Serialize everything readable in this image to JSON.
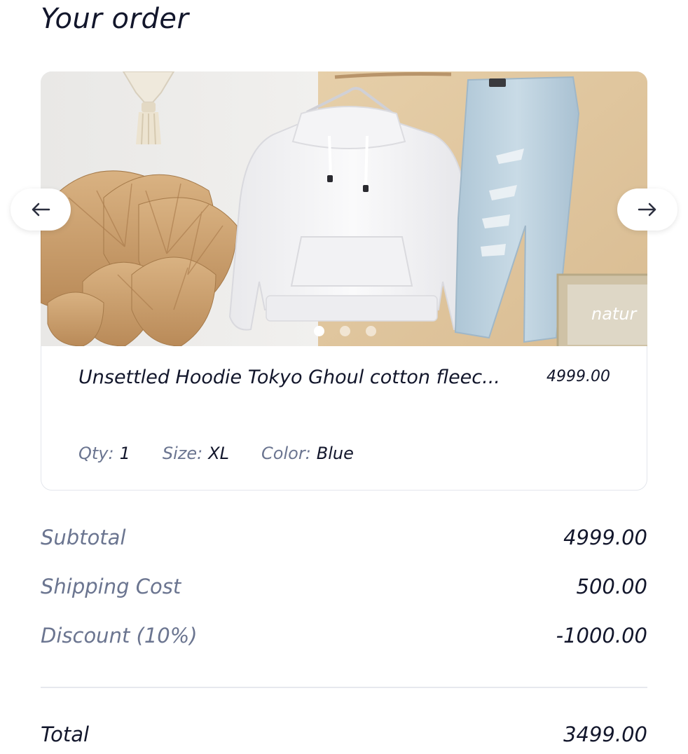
{
  "page": {
    "title": "Your order"
  },
  "carousel": {
    "prev_icon": "arrow-left-icon",
    "next_icon": "arrow-right-icon",
    "slide_count": 3,
    "active_slide": 1,
    "image_sign_text": "natur"
  },
  "product": {
    "name": "Unsettled Hoodie Tokyo Ghoul cotton fleec...",
    "price": "4999.00",
    "qty_label": "Qty:",
    "qty_value": "1",
    "size_label": "Size:",
    "size_value": "XL",
    "color_label": "Color:",
    "color_value": "Blue"
  },
  "summary": {
    "subtotal_label": "Subtotal",
    "subtotal_value": "4999.00",
    "shipping_label": "Shipping Cost",
    "shipping_value": "500.00",
    "discount_label": "Discount (10%)",
    "discount_value": "-1000.00",
    "total_label": "Total",
    "total_value": "3499.00"
  },
  "colors": {
    "text_primary": "#12162b",
    "text_muted": "#6b7590",
    "border": "#e3e6ec",
    "beige_wall": "#e2c9a3",
    "denim": "#b8cedc"
  }
}
